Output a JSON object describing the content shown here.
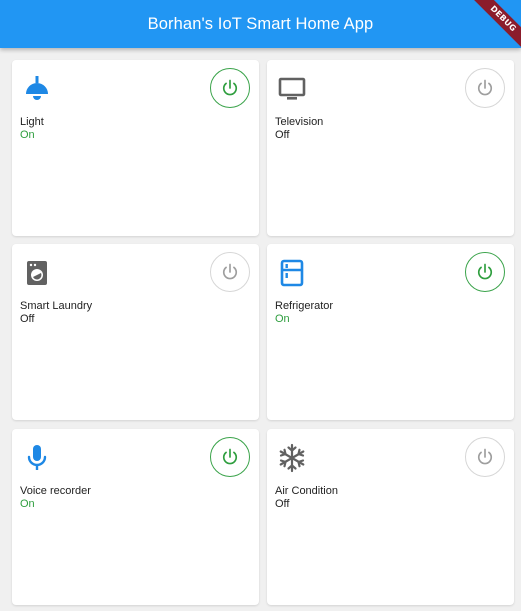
{
  "app": {
    "title": "Borhan's IoT Smart Home App",
    "debug_label": "DEBUG"
  },
  "colors": {
    "primary": "#2196f3",
    "on": "#2e9e3e",
    "off": "#9e9e9e",
    "icon_blue": "#1e88e5",
    "icon_grey": "#616161"
  },
  "devices": [
    {
      "name": "Light",
      "status": "On",
      "icon": "ceiling-light-icon"
    },
    {
      "name": "Television",
      "status": "Off",
      "icon": "tv-icon"
    },
    {
      "name": "Smart Laundry",
      "status": "Off",
      "icon": "washing-machine-icon"
    },
    {
      "name": "Refrigerator",
      "status": "On",
      "icon": "fridge-icon"
    },
    {
      "name": "Voice recorder",
      "status": "On",
      "icon": "microphone-icon"
    },
    {
      "name": "Air Condition",
      "status": "Off",
      "icon": "snowflake-icon"
    }
  ]
}
